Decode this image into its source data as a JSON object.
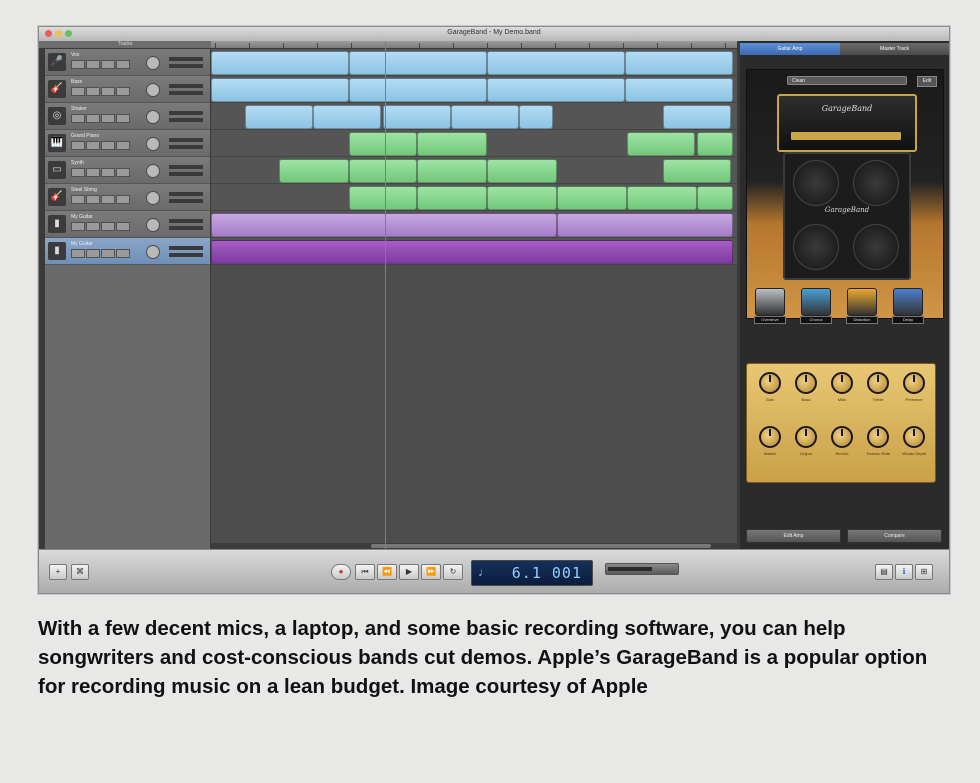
{
  "window": {
    "title": "GarageBand - My Demo.band",
    "colors": {
      "close": "#ee5a4f",
      "minimize": "#f4bf4f",
      "zoom": "#61c454"
    }
  },
  "track_header": {
    "label": "Tracks"
  },
  "tracks": [
    {
      "name": "Vox",
      "icon": "microphone-icon",
      "glyph": "🎤",
      "selected": false
    },
    {
      "name": "Bass",
      "icon": "bass-guitar-icon",
      "glyph": "🎸",
      "selected": false
    },
    {
      "name": "Shaker",
      "icon": "tambourine-icon",
      "glyph": "◎",
      "selected": false
    },
    {
      "name": "Grand Piano",
      "icon": "piano-icon",
      "glyph": "🎹",
      "selected": false
    },
    {
      "name": "Synth",
      "icon": "synth-keyboard-icon",
      "glyph": "▭",
      "selected": false
    },
    {
      "name": "Steel String",
      "icon": "acoustic-guitar-icon",
      "glyph": "🎸",
      "selected": false
    },
    {
      "name": "My Guitar",
      "icon": "amp-icon",
      "glyph": "▮",
      "selected": false
    },
    {
      "name": "My Guitar",
      "icon": "amp-icon",
      "glyph": "▮",
      "selected": true
    }
  ],
  "inspector": {
    "tabs": [
      "Guitar Amp",
      "Master Track"
    ],
    "preset": "Clean",
    "edit_label": "Edit",
    "amp_brand": "GarageBand",
    "pedals": [
      {
        "label": "Overdrive",
        "color": "#b8c0c6"
      },
      {
        "label": "Chorus",
        "color": "#4a9fd8"
      },
      {
        "label": "Distortion",
        "color": "#e9a832"
      },
      {
        "label": "Delay",
        "color": "#4d7fd2"
      }
    ],
    "knobs_row1": [
      "Gain",
      "Bass",
      "Mids",
      "Treble",
      "Presence"
    ],
    "knobs_row2": [
      "Master",
      "Output",
      "Reverb",
      "Tremolo Rate",
      "Vibrato Depth"
    ],
    "bottom_buttons": [
      "Edit Amp",
      "Compare"
    ]
  },
  "transport": {
    "lcd_value": "6.1 001",
    "lcd_icon": "♩",
    "volume_fraction": 0.65,
    "left_buttons": [
      "+",
      "⌘"
    ],
    "buttons": [
      "●",
      "⏮",
      "⏪",
      "▶",
      "⏩",
      "↻"
    ],
    "right_buttons": [
      "▤",
      "ℹ",
      "⊞"
    ]
  },
  "caption": "With a few decent mics, a laptop, and some basic recording software, you can help songwriters and cost-conscious bands cut demos. Apple’s GarageBand is a popular option for recording music on a lean budget. Image courtesy of Apple"
}
